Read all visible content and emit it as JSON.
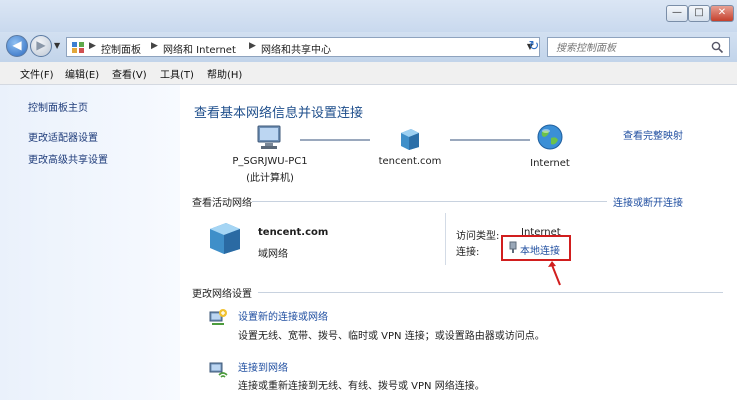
{
  "window": {
    "minimize": "—",
    "maximize": "□",
    "close": "✕"
  },
  "nav": {
    "breadcrumb": [
      "控制面板",
      "网络和 Internet",
      "网络和共享中心"
    ],
    "refresh": "↻",
    "search_placeholder": "搜索控制面板"
  },
  "menu": [
    "文件(F)",
    "编辑(E)",
    "查看(V)",
    "工具(T)",
    "帮助(H)"
  ],
  "sidebar": {
    "items": [
      {
        "label": "控制面板主页"
      },
      {
        "label": "更改适配器设置"
      },
      {
        "label": "更改高级共享设置"
      }
    ]
  },
  "main": {
    "title": "查看基本网络信息并设置连接",
    "view_full_map": "查看完整映射",
    "map": {
      "computer_name": "P_SGRJWU-PC1",
      "computer_sub": "(此计算机)",
      "network_name": "tencent.com",
      "internet": "Internet"
    },
    "active": {
      "heading": "查看活动网络",
      "connect_link": "连接或断开连接",
      "network_name": "tencent.com",
      "network_type": "域网络",
      "access_type_label": "访问类型:",
      "access_type_value": "Internet",
      "connection_label": "连接:",
      "connection_value": "本地连接"
    },
    "change": {
      "heading": "更改网络设置",
      "tasks": [
        {
          "title": "设置新的连接或网络",
          "desc": "设置无线、宽带、拨号、临时或 VPN 连接；或设置路由器或访问点。"
        },
        {
          "title": "连接到网络",
          "desc": "连接或重新连接到无线、有线、拨号或 VPN 网络连接。"
        }
      ]
    }
  },
  "colors": {
    "link": "#1f4ea0",
    "title": "#1f4f8c",
    "highlight": "#d11e1e"
  }
}
